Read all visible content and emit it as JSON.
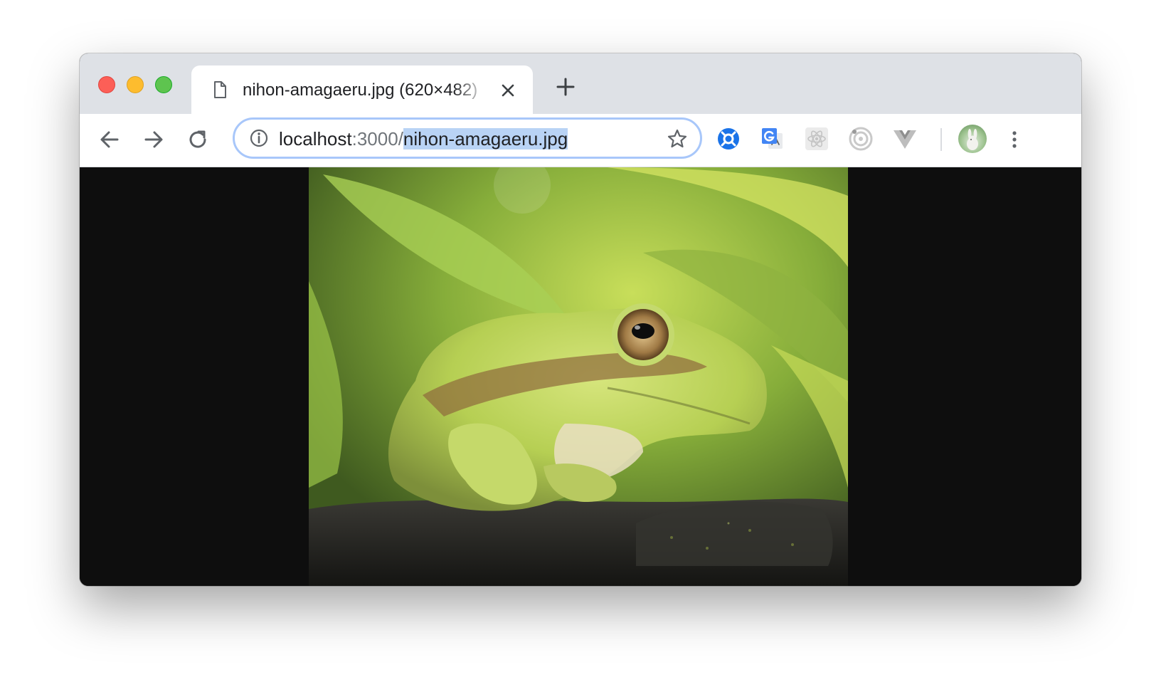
{
  "window": {
    "tab": {
      "title": "nihon-amagaeru.jpg (620×482)",
      "icon": "file-icon",
      "close_icon": "close-icon"
    },
    "new_tab_icon": "plus-icon"
  },
  "toolbar": {
    "back_icon": "arrow-left-icon",
    "forward_icon": "arrow-right-icon",
    "reload_icon": "reload-icon",
    "omnibox": {
      "info_icon": "info-icon",
      "host": "localhost",
      "port": ":3000/",
      "path": "nihon-amagaeru.jpg",
      "bookmark_icon": "star-icon"
    },
    "extensions": [
      "blue-compass-extension-icon",
      "google-translate-extension-icon",
      "react-devtools-extension-icon",
      "target-extension-icon",
      "vue-devtools-extension-icon"
    ],
    "avatar": "profile-avatar",
    "menu_icon": "kebab-menu-icon"
  },
  "content": {
    "image_alt": "Japanese tree frog on a dark stone among green leaves",
    "image_file": "nihon-amagaeru.jpg"
  },
  "colors": {
    "tabstrip": "#dee1e6",
    "omnibox_focus": "#a8c7fa",
    "selection": "#b9d3f5",
    "viewer_background": "#0e0e0e"
  }
}
